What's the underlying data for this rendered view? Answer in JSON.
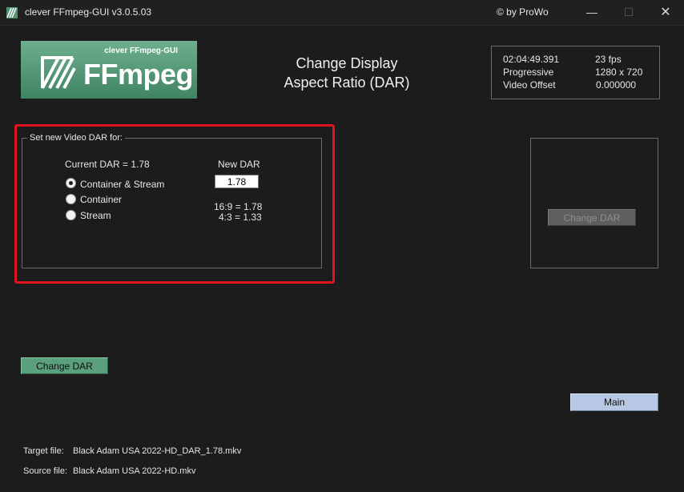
{
  "window": {
    "title": "clever FFmpeg-GUI v3.0.5.03",
    "credit": "© by ProWo",
    "min_glyph": "—",
    "max_glyph": "☐",
    "close_glyph": "✕"
  },
  "logo": {
    "subtitle": "clever FFmpeg-GUI",
    "wordmark": "FFmpeg"
  },
  "heading": {
    "line1": "Change Display",
    "line2": "Aspect Ratio (DAR)"
  },
  "info": {
    "duration": "02:04:49.391",
    "fps": "23 fps",
    "scan": "Progressive",
    "resolution": "1280 x 720",
    "offset_label": "Video Offset",
    "offset_value": "0.000000"
  },
  "dar_group": {
    "legend": "Set new Video DAR for:",
    "current_dar": "Current DAR = 1.78",
    "new_dar_label": "New DAR",
    "new_dar_value": "1.78",
    "ratio_16_9": "16:9 = 1.78",
    "ratio_4_3": "4:3 = 1.33",
    "options": [
      {
        "label": "Container & Stream",
        "selected": true
      },
      {
        "label": "Container",
        "selected": false
      },
      {
        "label": "Stream",
        "selected": false
      }
    ]
  },
  "buttons": {
    "change_dar_disabled": "Change DAR",
    "change_dar": "Change DAR",
    "main": "Main"
  },
  "files": {
    "target_label": "Target file:",
    "target_value": "Black Adam USA 2022-HD_DAR_1.78.mkv",
    "source_label": "Source file:",
    "source_value": "Black Adam USA 2022-HD.mkv"
  },
  "colors": {
    "highlight": "#e0141e",
    "green_button": "#5aa07e",
    "blue_button": "#b7c8e4",
    "logo_gradient": "#4f9373"
  },
  "icons": [
    "app-icon",
    "ffmpeg-logo-icon"
  ]
}
